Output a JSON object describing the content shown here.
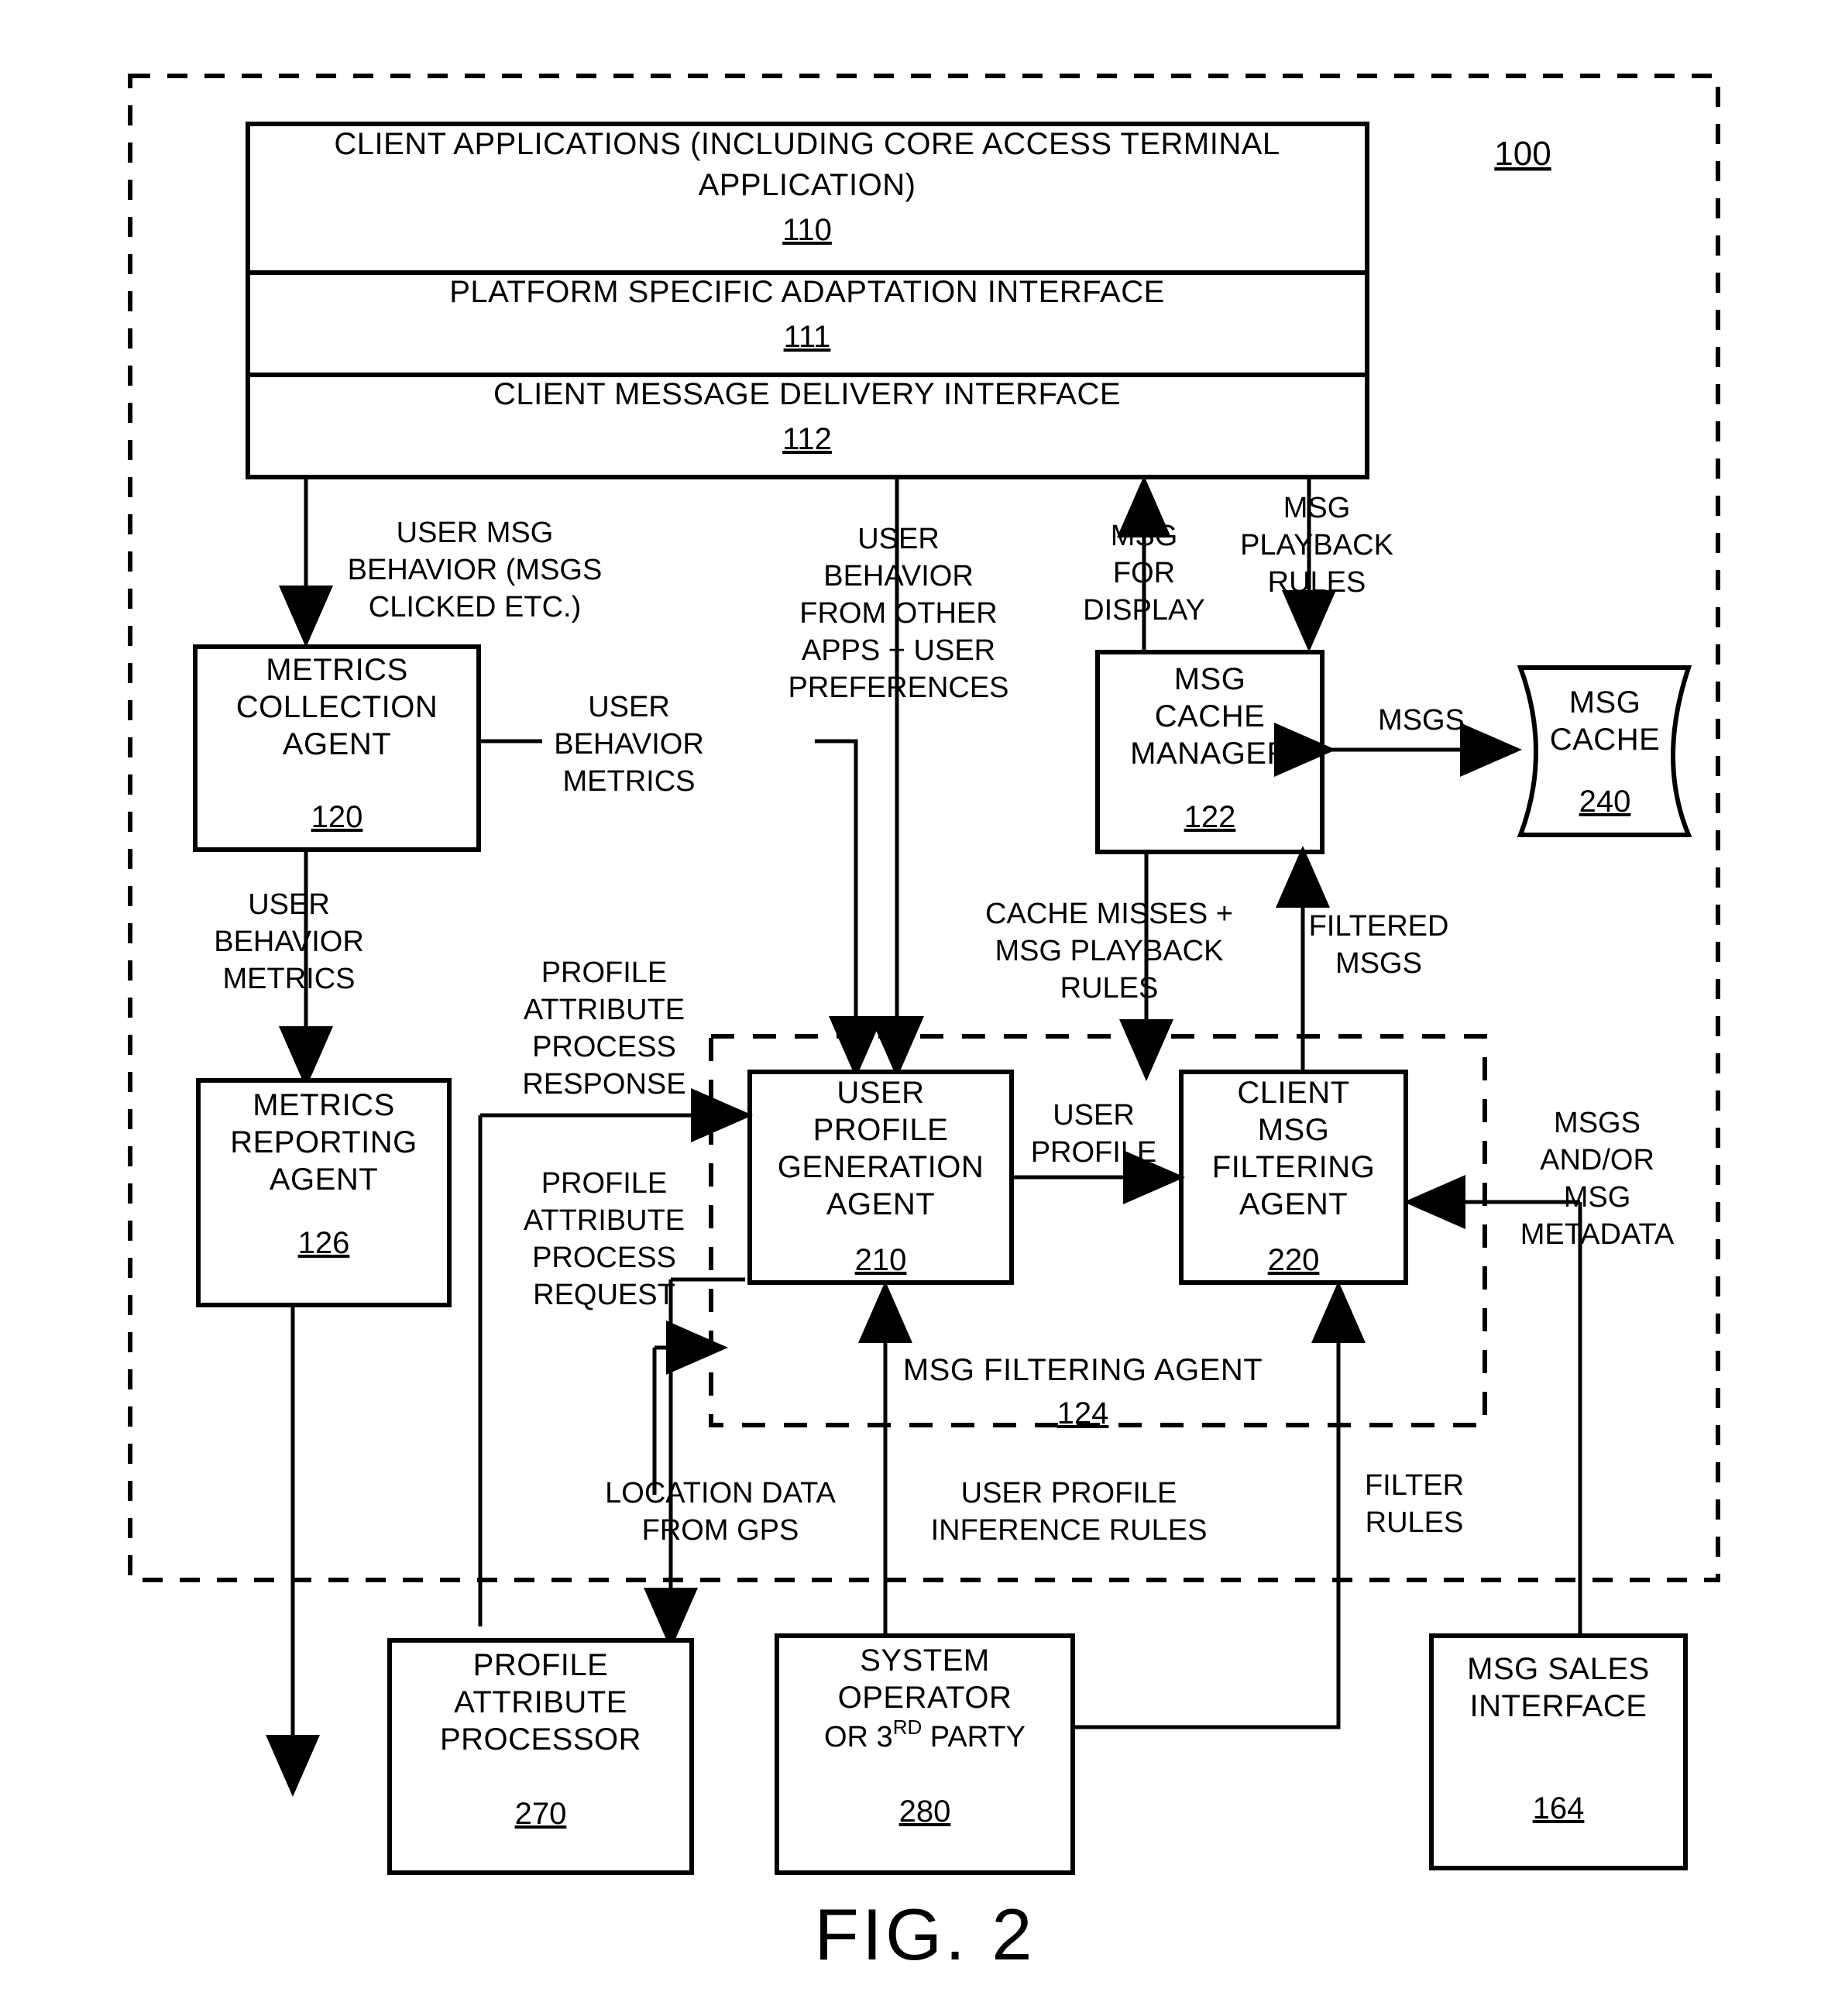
{
  "figure": {
    "caption": "FIG. 2",
    "system_ref": "100"
  },
  "stack": {
    "rows": [
      {
        "label": "CLIENT APPLICATIONS (INCLUDING CORE ACCESS TERMINAL",
        "label2": "APPLICATION)",
        "ref": "110"
      },
      {
        "label": "PLATFORM SPECIFIC ADAPTATION INTERFACE",
        "label2": "",
        "ref": "111"
      },
      {
        "label": "CLIENT MESSAGE DELIVERY INTERFACE",
        "label2": "",
        "ref": "112"
      }
    ]
  },
  "boxes": {
    "metrics_collection_agent": {
      "l1": "METRICS",
      "l2": "COLLECTION",
      "l3": "AGENT",
      "ref": "120"
    },
    "metrics_reporting_agent": {
      "l1": "METRICS",
      "l2": "REPORTING",
      "l3": "AGENT",
      "ref": "126"
    },
    "msg_cache_manager": {
      "l1": "MSG",
      "l2": "CACHE",
      "l3": "MANAGER",
      "ref": "122"
    },
    "msg_cache": {
      "l1": "MSG",
      "l2": "CACHE",
      "ref": "240"
    },
    "user_profile_generation_agent": {
      "l1": "USER",
      "l2": "PROFILE",
      "l3": "GENERATION",
      "l4": "AGENT",
      "ref": "210"
    },
    "client_msg_filtering_agent": {
      "l1": "CLIENT",
      "l2": "MSG",
      "l3": "FILTERING",
      "l4": "AGENT",
      "ref": "220"
    },
    "msg_filtering_agent_group": {
      "l1": "MSG FILTERING AGENT",
      "ref": "124"
    },
    "profile_attribute_processor": {
      "l1": "PROFILE",
      "l2": "ATTRIBUTE",
      "l3": "PROCESSOR",
      "ref": "270"
    },
    "system_operator": {
      "l1": "SYSTEM",
      "l2": "OPERATOR",
      "l3a": "OR 3",
      "l3sup": "RD",
      "l3b": " PARTY",
      "ref": "280"
    },
    "msg_sales_interface": {
      "l1": "MSG SALES",
      "l2": "INTERFACE",
      "ref": "164"
    }
  },
  "edge_labels": {
    "user_msg_behavior": {
      "l1": "USER MSG",
      "l2": "BEHAVIOR (MSGS",
      "l3": "CLICKED ETC.)"
    },
    "user_behavior_other_apps": {
      "l1": "USER",
      "l2": "BEHAVIOR",
      "l3": "FROM OTHER",
      "l4": "APPS + USER",
      "l5": "PREFERENCES"
    },
    "msg_for_display": {
      "l1": "MSG",
      "l2": "FOR",
      "l3": "DISPLAY"
    },
    "msg_playback_rules_top": {
      "l1": "MSG",
      "l2": "PLAYBACK",
      "l3": "RULES"
    },
    "user_behavior_metrics_side": {
      "l1": "USER",
      "l2": "BEHAVIOR",
      "l3": "METRICS"
    },
    "user_behavior_metrics_down": {
      "l1": "USER",
      "l2": "BEHAVIOR",
      "l3": "METRICS"
    },
    "msgs_cache": {
      "l1": "MSGS"
    },
    "cache_misses": {
      "l1": "CACHE MISSES +",
      "l2": "MSG PLAYBACK",
      "l3": "RULES"
    },
    "filtered_msgs": {
      "l1": "FILTERED",
      "l2": "MSGS"
    },
    "profile_attr_response": {
      "l1": "PROFILE",
      "l2": "ATTRIBUTE",
      "l3": "PROCESS",
      "l4": "RESPONSE"
    },
    "profile_attr_request": {
      "l1": "PROFILE",
      "l2": "ATTRIBUTE",
      "l3": "PROCESS",
      "l4": "REQUEST"
    },
    "user_profile": {
      "l1": "USER",
      "l2": "PROFILE"
    },
    "msgs_and_or_metadata": {
      "l1": "MSGS",
      "l2": "AND/OR",
      "l3": "MSG",
      "l4": "METADATA"
    },
    "location_data": {
      "l1": "LOCATION DATA",
      "l2": "FROM GPS"
    },
    "user_profile_inference": {
      "l1": "USER PROFILE",
      "l2": "INFERENCE RULES"
    },
    "filter_rules": {
      "l1": "FILTER",
      "l2": "RULES"
    }
  }
}
